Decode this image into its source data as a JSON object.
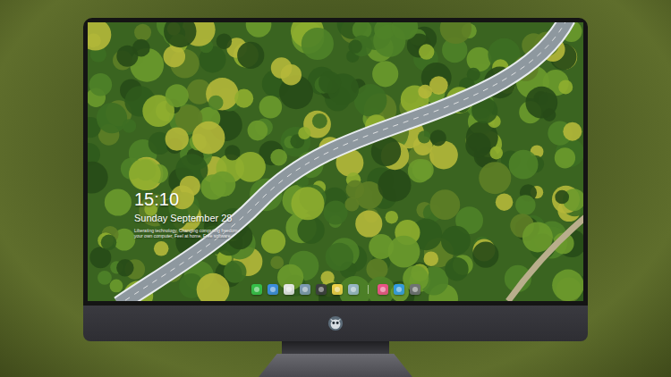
{
  "desktop": {
    "time": "15:10",
    "date": "Sunday September 28",
    "tagline": [
      "Liberating technology, Changing computing freedom",
      "your own computer, Feel at home, Free software"
    ]
  },
  "dock": {
    "items": [
      {
        "kind": "app",
        "color": "#35c24a"
      },
      {
        "kind": "app",
        "color": "#3a8ee6"
      },
      {
        "kind": "app",
        "color": "#e9e9ec"
      },
      {
        "kind": "app",
        "color": "#7f9bb8"
      },
      {
        "kind": "app",
        "color": "#3b3b40"
      },
      {
        "kind": "app",
        "color": "#f3d44a"
      },
      {
        "kind": "app",
        "color": "#9ab7cc"
      },
      {
        "kind": "separator",
        "color": "#ffffff"
      },
      {
        "kind": "app",
        "color": "#f0508a"
      },
      {
        "kind": "app",
        "color": "#2f9ae8"
      },
      {
        "kind": "app",
        "color": "#6f7076"
      }
    ]
  }
}
